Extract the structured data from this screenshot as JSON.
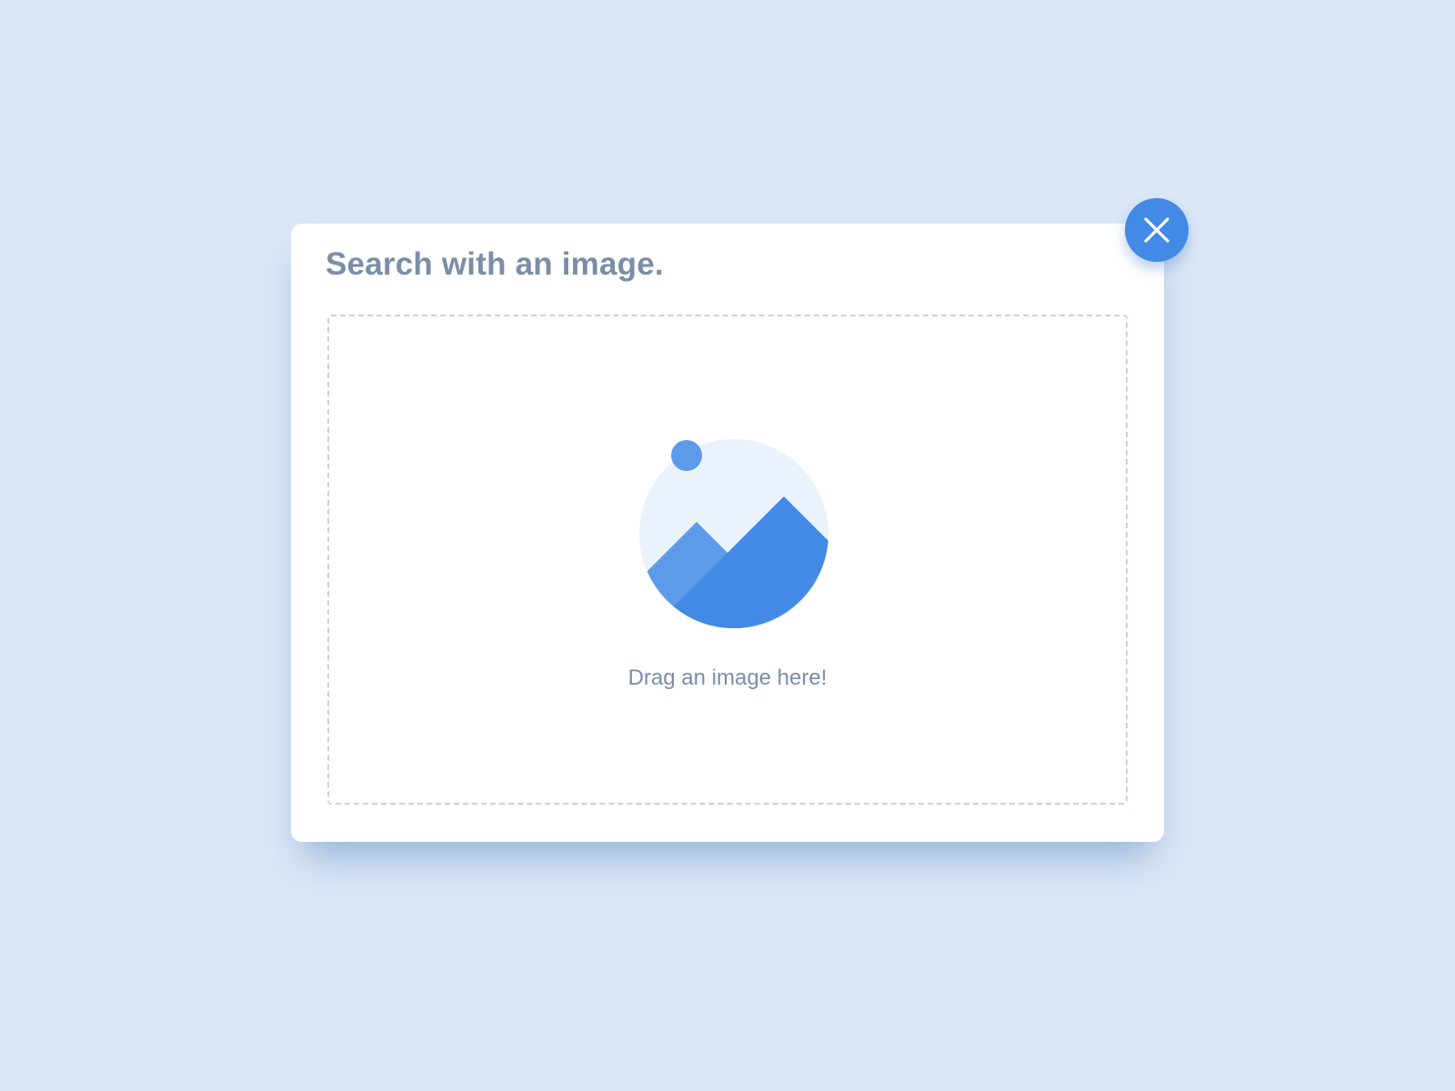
{
  "dialog": {
    "title": "Search with an image.",
    "dropzone_text": "Drag an image here!",
    "close_icon": "close-icon",
    "illustration_icon": "image-landscape-icon"
  },
  "colors": {
    "background": "#dbe7f6",
    "accent": "#428ae6",
    "accent_light": "#5c9be9",
    "illustration_bg": "#eaf2fc",
    "text": "#7a8ea6",
    "dropzone_border": "#c5d3e0"
  }
}
